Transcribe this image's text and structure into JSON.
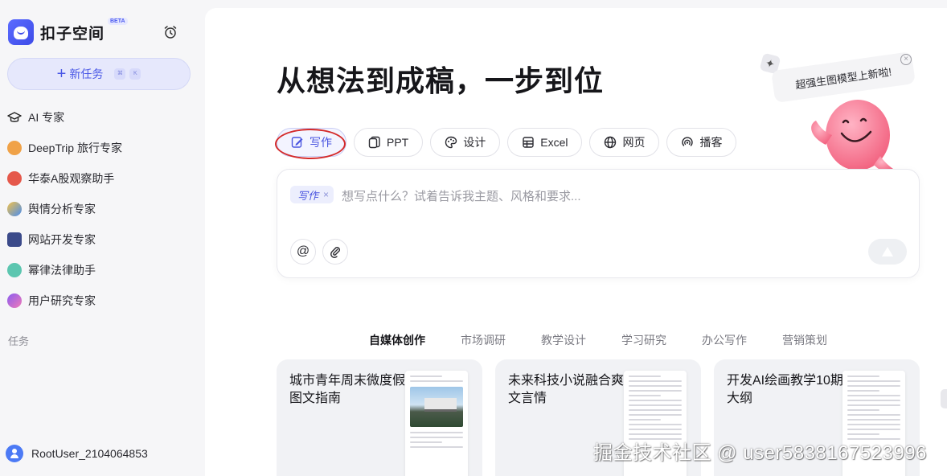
{
  "app": {
    "name": "扣子空间",
    "badge": "BETA"
  },
  "sidebar": {
    "new_task_label": "新任务",
    "shortcut_keys": [
      "⌘",
      "K"
    ],
    "items": [
      {
        "label": "AI 专家",
        "icon": "graduation-cap-icon"
      },
      {
        "label": "DeepTrip 旅行专家",
        "icon": "tiger-icon"
      },
      {
        "label": "华泰A股观察助手",
        "icon": "flower-icon"
      },
      {
        "label": "舆情分析专家",
        "icon": "analysis-icon"
      },
      {
        "label": "网站开发专家",
        "icon": "monitor-icon"
      },
      {
        "label": "幂律法律助手",
        "icon": "book-icon"
      },
      {
        "label": "用户研究专家",
        "icon": "research-icon"
      }
    ],
    "section_label": "任务",
    "user_name": "RootUser_2104064853"
  },
  "main": {
    "headline": "从想法到成稿，一步到位",
    "tools": [
      {
        "label": "写作",
        "icon": "pen-icon",
        "active": true
      },
      {
        "label": "PPT",
        "icon": "ppt-icon"
      },
      {
        "label": "设计",
        "icon": "palette-icon"
      },
      {
        "label": "Excel",
        "icon": "table-icon"
      },
      {
        "label": "网页",
        "icon": "globe-icon"
      },
      {
        "label": "播客",
        "icon": "podcast-icon"
      }
    ],
    "promo_text": "超强生图模型上新啦!",
    "input": {
      "chip_label": "写作",
      "placeholder": "想写点什么？试着告诉我主题、风格和要求..."
    },
    "category_tabs": [
      "自媒体创作",
      "市场调研",
      "教学设计",
      "学习研究",
      "办公写作",
      "营销策划"
    ],
    "active_category": "自媒体创作",
    "cards": [
      {
        "title": "城市青年周末微度假图文指南"
      },
      {
        "title": "未来科技小说融合爽文言情"
      },
      {
        "title": "开发AI绘画教学10期大纲"
      }
    ]
  },
  "watermark": "掘金技术社区 @ user5838167523996",
  "colors": {
    "accent": "#4a55e0",
    "highlight_circle": "#d42a2a"
  }
}
